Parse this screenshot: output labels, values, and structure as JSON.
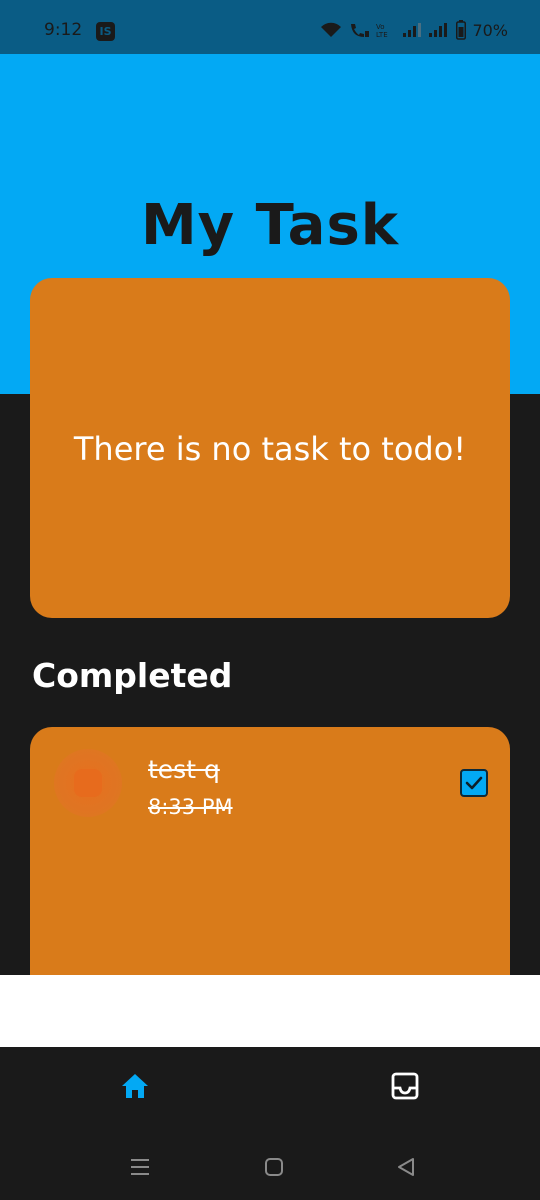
{
  "status_bar": {
    "time": "9:12",
    "app_icon_letters": "IS",
    "battery": "70%",
    "icons": [
      "wifi-icon",
      "volte-call-icon",
      "volte-lte-icon",
      "signal-icon",
      "signal-icon",
      "battery-icon"
    ]
  },
  "header": {
    "title": "My Task",
    "background_color": "#03a9f4"
  },
  "todo": {
    "empty_message": "There is no task to todo!",
    "card_color": "#d97b1a"
  },
  "completed": {
    "heading": "Completed",
    "tasks": [
      {
        "title": "test q",
        "time": "8:33 PM",
        "checked": true
      }
    ]
  },
  "bottom_nav": {
    "items": [
      {
        "icon": "home-icon",
        "active": true,
        "color": "#03a9f4"
      },
      {
        "icon": "inbox-icon",
        "active": false,
        "color": "#ffffff"
      }
    ]
  },
  "system_nav": {
    "items": [
      "recent-apps-icon",
      "home-button-icon",
      "back-icon"
    ]
  }
}
